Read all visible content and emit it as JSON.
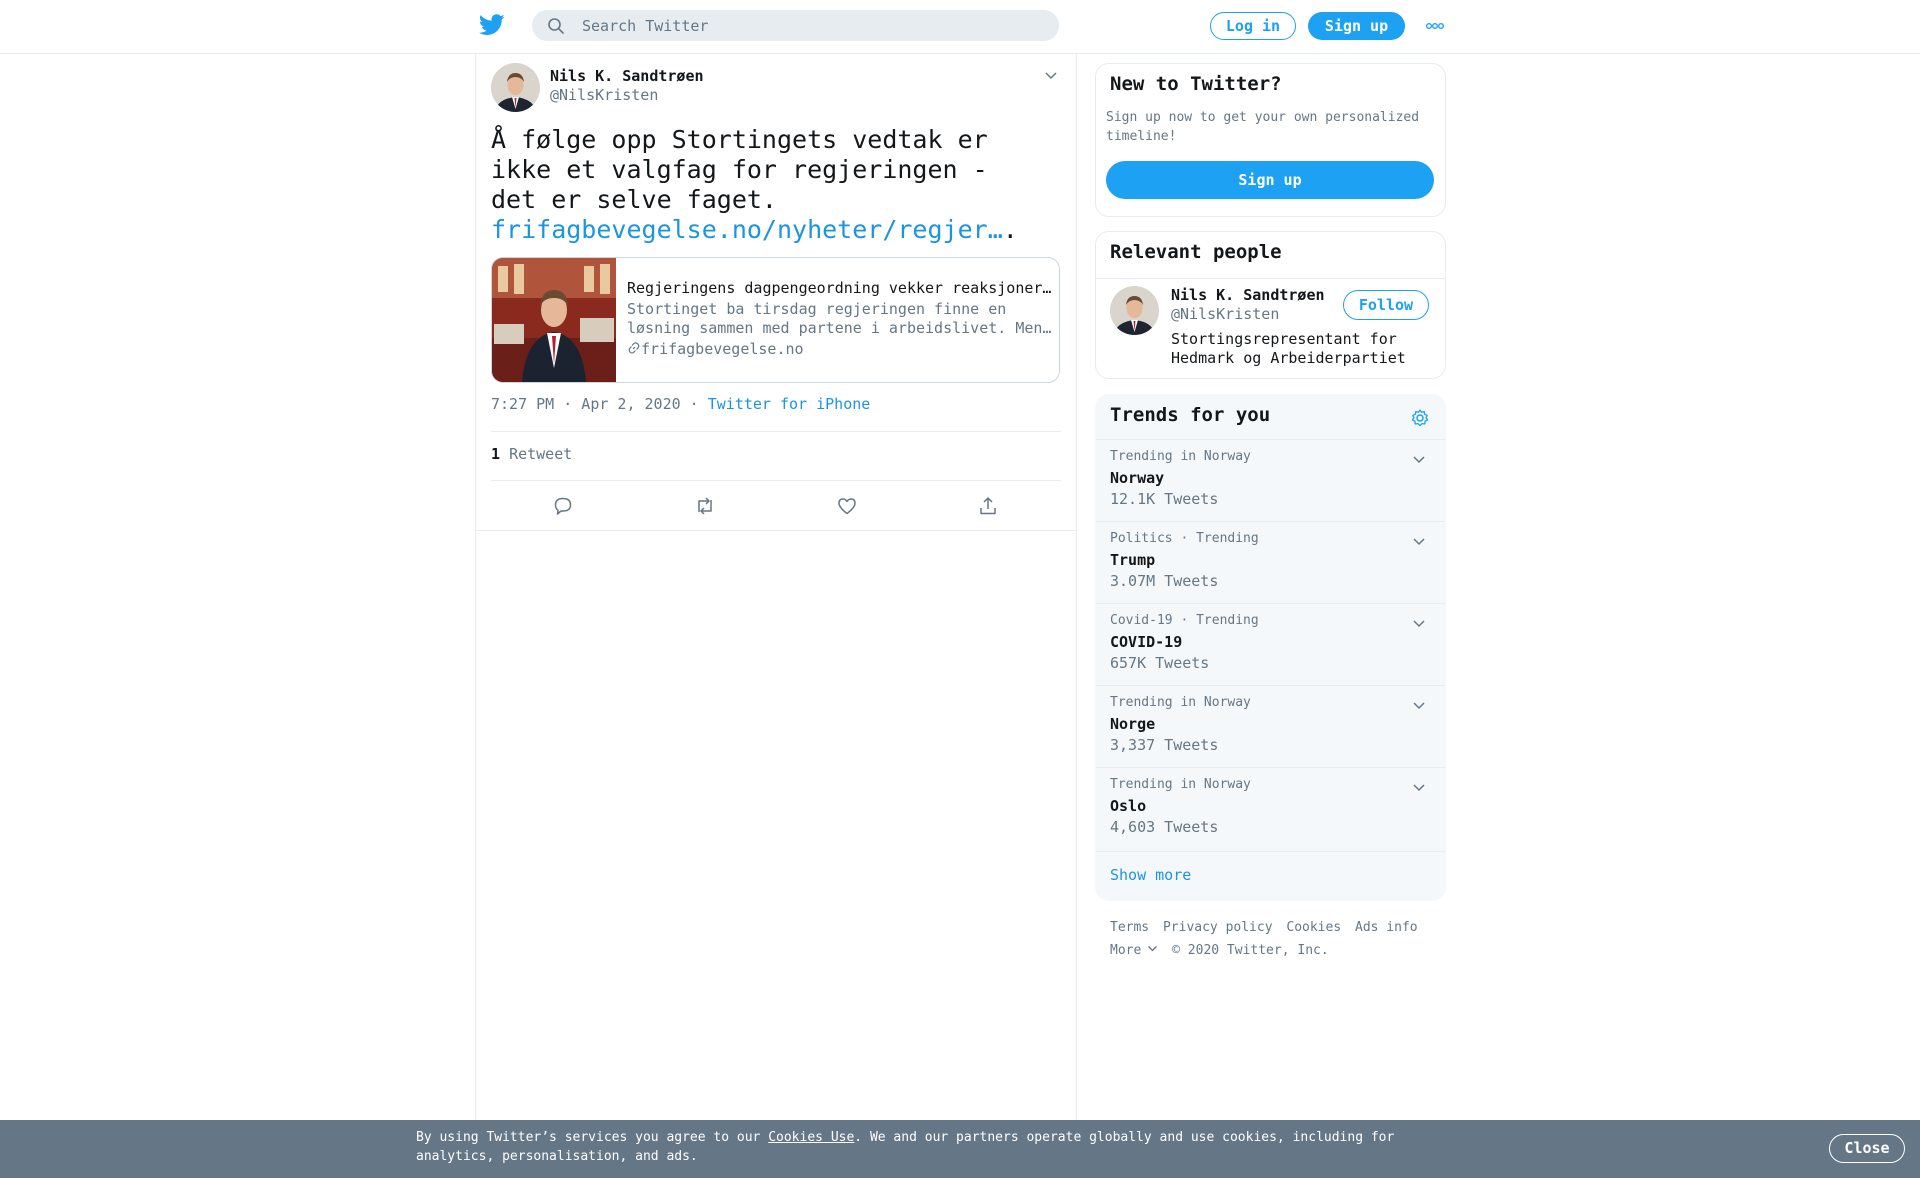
{
  "header": {
    "search_placeholder": "Search Twitter",
    "login_label": "Log in",
    "signup_label": "Sign up",
    "logo_icon": "twitter-bird-icon",
    "more_icon": "more-dots-icon"
  },
  "tweet": {
    "author_name": "Nils K. Sandtrøen",
    "author_handle": "@NilsKristen",
    "text": "Å følge opp Stortingets vedtak er ikke et valgfag for regjeringen -\ndet er selve faget.",
    "link_text": "frifagbevegelse.no/nyheter/regjer…",
    "link_suffix": ".",
    "card": {
      "title": "Regjeringens dagpengeordning vekker reaksjoner i LO",
      "desc_line1": "Stortinget ba tirsdag regjeringen finne en",
      "desc_line2": "løsning sammen med partene i arbeidslivet. Men...",
      "domain": "frifagbevegelse.no"
    },
    "time": "7:27 PM · Apr 2, 2020",
    "separator": " · ",
    "source": "Twitter for iPhone",
    "retweet_count": "1",
    "retweet_label": "Retweet"
  },
  "sidebar": {
    "new_title": "New to Twitter?",
    "new_text": "Sign up now to get your own personalized timeline!",
    "new_signup": "Sign up",
    "relevant_title": "Relevant people",
    "relevant": {
      "name": "Nils K. Sandtrøen",
      "handle": "@NilsKristen",
      "follow_label": "Follow",
      "bio": "Stortingsrepresentant for Hedmark og Arbeiderpartiet"
    },
    "trends_title": "Trends for you",
    "trends": [
      {
        "context": "Trending in Norway",
        "name": "Norway",
        "count": "12.1K Tweets"
      },
      {
        "context": "Politics · Trending",
        "name": "Trump",
        "count": "3.07M Tweets"
      },
      {
        "context": "Covid-19 · Trending",
        "name": "COVID-19",
        "count": "657K Tweets"
      },
      {
        "context": "Trending in Norway",
        "name": "Norge",
        "count": "3,337 Tweets"
      },
      {
        "context": "Trending in Norway",
        "name": "Oslo",
        "count": "4,603 Tweets"
      }
    ],
    "show_more": "Show more"
  },
  "footer": {
    "links": [
      "Terms",
      "Privacy policy",
      "Cookies",
      "Ads info"
    ],
    "more": "More",
    "copyright": "© 2020 Twitter, Inc."
  },
  "cookies": {
    "text_before": "By using Twitter’s services you agree to our ",
    "link": "Cookies Use",
    "text_after": ". We and our partners operate globally and use cookies, including for analytics, personalisation, and ads.",
    "close_label": "Close"
  },
  "colors": {
    "accent": "#1da1f2",
    "link": "#1b95e0",
    "muted": "#657786",
    "cookie_bar": "#657786"
  }
}
